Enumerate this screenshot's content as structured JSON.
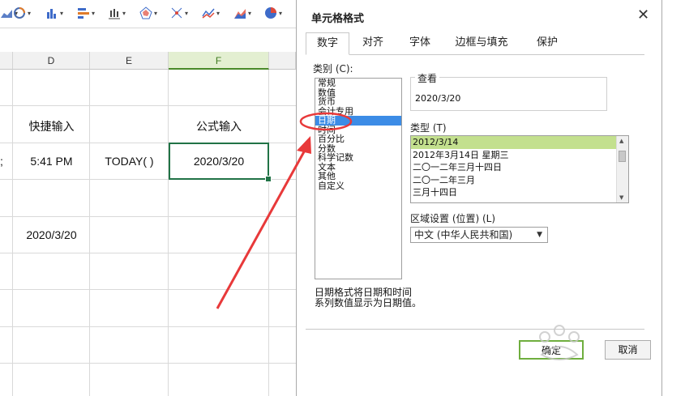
{
  "toolbar": {
    "buttons": [
      {
        "icon": "area-chart-icon"
      },
      {
        "icon": "pie-ring-chart-icon"
      },
      {
        "icon": "column-chart-icon"
      },
      {
        "icon": "bar-chart-icon"
      },
      {
        "icon": "stock-chart-icon"
      },
      {
        "icon": "radar-chart-icon"
      },
      {
        "icon": "scatter-chart-icon"
      },
      {
        "icon": "line-chart-icon"
      },
      {
        "icon": "mountain-chart-icon"
      },
      {
        "icon": "pie-chart-icon"
      }
    ]
  },
  "sheet": {
    "columns": [
      "D",
      "E",
      "F"
    ],
    "selected_column": "F",
    "cells": {
      "d_header": "快捷输入",
      "f_header": "公式输入",
      "c_partial": ";",
      "d_time": "5:41 PM",
      "e_func": "TODAY( )",
      "f_date": "2020/3/20",
      "d_date": "2020/3/20"
    }
  },
  "dialog": {
    "title": "单元格格式",
    "close_glyph": "✕",
    "tabs": [
      "数字",
      "对齐",
      "字体",
      "边框与填充",
      "保护"
    ],
    "active_tab": "数字",
    "category_label": "类别 (C):",
    "categories": [
      "常规",
      "数值",
      "货币",
      "会计专用",
      "日期",
      "时间",
      "百分比",
      "分数",
      "科学记数",
      "文本",
      "其他",
      "自定义"
    ],
    "selected_category": "日期",
    "preview_label": "查看",
    "preview_value": "2020/3/20",
    "type_label": "类型 (T)",
    "types": [
      "2012/3/14",
      "2012年3月14日 星期三",
      "二〇一二年三月十四日",
      "二〇一二年三月",
      "三月十四日"
    ],
    "selected_type": "2012/3/14",
    "locale_label": "区域设置 (位置) (L)",
    "locale_value": "中文 (中华人民共和国)",
    "description_line1": "日期格式将日期和时间",
    "description_line2": "系列数值显示为日期值。",
    "ok_label": "确定",
    "cancel_label": "取消"
  },
  "colors": {
    "accent_green": "#217346",
    "selection_blue": "#3c8ce6",
    "type_selection": "#c3e08e",
    "annotation_red": "#e8393a"
  }
}
